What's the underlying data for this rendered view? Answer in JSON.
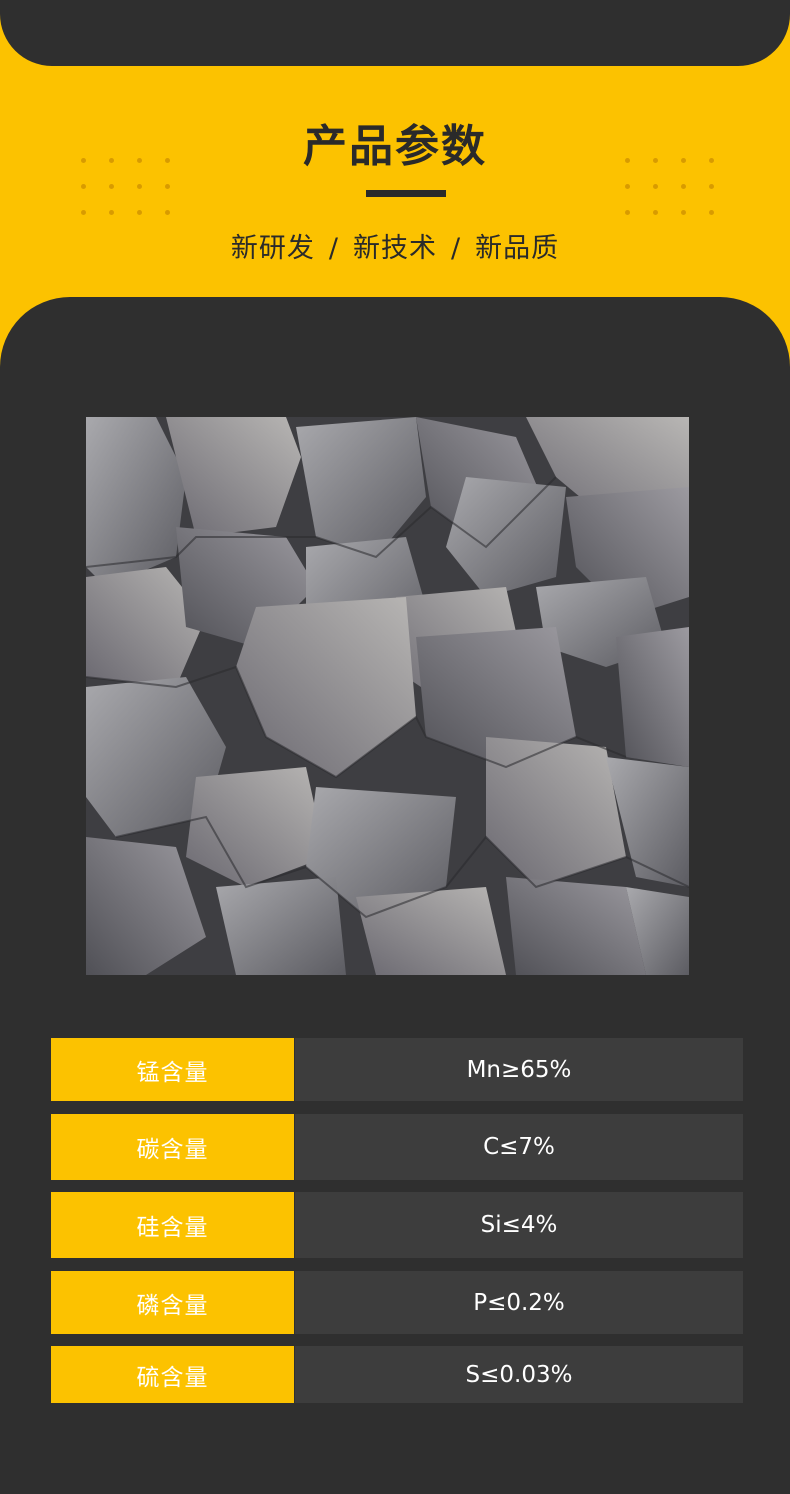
{
  "header": {
    "title": "产品参数",
    "subtitle_items": [
      "新研发",
      "新技术",
      "新品质"
    ],
    "separator": "/"
  },
  "colors": {
    "accent": "#fcc200",
    "dark": "#2f2f2f",
    "row_bg": "#3d3d3d",
    "text_dark": "#2a2a2a",
    "text_light": "#ffffff"
  },
  "product_image": {
    "subject": "silicomanganese alloy lumps"
  },
  "specs": [
    {
      "label": "锰含量",
      "value": "Mn≥65%"
    },
    {
      "label": "碳含量",
      "value": "C≤7%"
    },
    {
      "label": "硅含量",
      "value": "Si≤4%"
    },
    {
      "label": "磷含量",
      "value": "P≤0.2%"
    },
    {
      "label": "硫含量",
      "value": "S≤0.03%"
    }
  ]
}
